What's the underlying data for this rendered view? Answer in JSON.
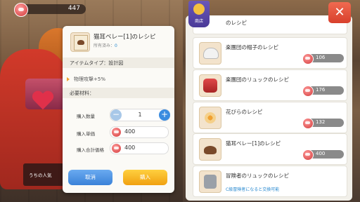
{
  "currency": {
    "amount": "447"
  },
  "chat": {
    "text": "うちの人気"
  },
  "dialog": {
    "title": "猫耳ベレー[1]のレシピ",
    "owned_label": "所有済み：",
    "owned_count": "0",
    "item_type": "アイテムタイプ：設計図",
    "effect": "物理攻撃+5%",
    "materials_label": "必要材料：",
    "qty_label": "購入数量",
    "qty_value": "1",
    "unit_price_label": "購入単価",
    "unit_price": "400",
    "total_price_label": "購入合計価格",
    "total_price": "400",
    "cancel_label": "取消",
    "buy_label": "購入"
  },
  "shop": {
    "badge_label": "商店",
    "top_partial_name": "のレシピ",
    "items": [
      {
        "name": "楽團団の帽子のレシピ",
        "price": "106",
        "icon": "hat-icon"
      },
      {
        "name": "楽團団のリュックのレシピ",
        "price": "176",
        "icon": "backpack-icon"
      },
      {
        "name": "花びらのレシピ",
        "price": "132",
        "icon": "flower-icon"
      },
      {
        "name": "猫耳ベレー[1]のレシピ",
        "price": "400",
        "icon": "beret-icon"
      },
      {
        "name": "冒険者のリュックのレシピ",
        "note": "C級冒険者になると交換可能",
        "icon": "locked-pack-icon"
      }
    ]
  },
  "colors": {
    "accent_blue": "#3a82d8",
    "accent_yellow": "#f0a010",
    "close_red": "#d8402c",
    "badge_purple": "#4a3a98"
  }
}
